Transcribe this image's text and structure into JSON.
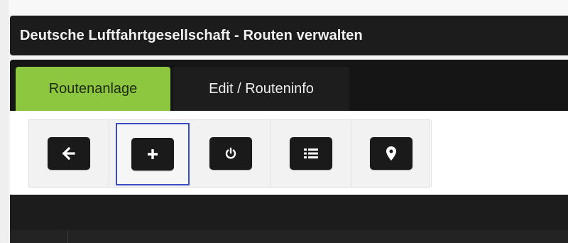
{
  "window": {
    "title": "Deutsche Luftfahrtgesellschaft - Routen verwalten"
  },
  "tabs": [
    {
      "label": "Routenanlage",
      "active": true
    },
    {
      "label": "Edit / Routeninfo",
      "active": false
    }
  ],
  "toolbar": {
    "buttons": [
      {
        "icon": "arrow-left-icon",
        "selected": false
      },
      {
        "icon": "plus-icon",
        "selected": true
      },
      {
        "icon": "power-icon",
        "selected": false
      },
      {
        "icon": "list-icon",
        "selected": false
      },
      {
        "icon": "map-marker-icon",
        "selected": false
      }
    ]
  },
  "colors": {
    "title_bar": "#1c1c1c",
    "active_tab": "#8dc63f",
    "selection_outline": "#3a4bc4",
    "button_bg": "#1a1a1a"
  }
}
